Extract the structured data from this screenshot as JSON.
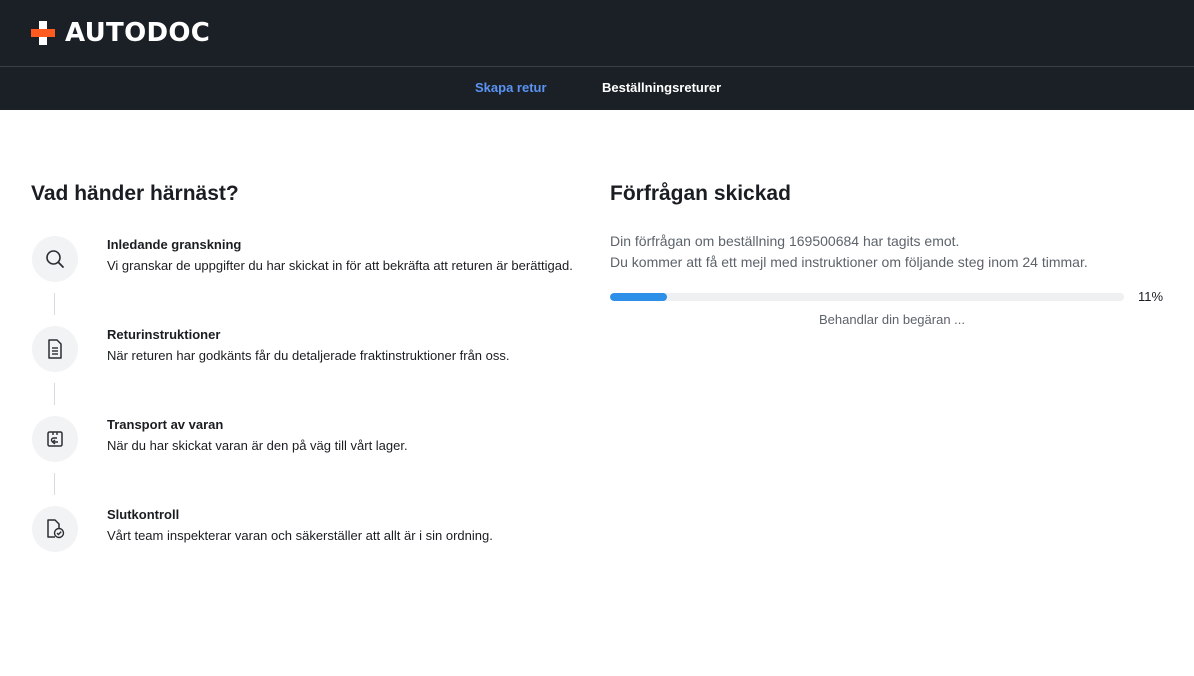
{
  "header": {
    "logo_text": "AUTODOC",
    "brand_color": "#ff5a1f",
    "background_color": "#1b2026"
  },
  "nav": {
    "tabs": [
      {
        "label": "Skapa retur",
        "active": true
      },
      {
        "label": "Beställningsreturer",
        "active": false
      }
    ],
    "active_color": "#5a93f2"
  },
  "left": {
    "title": "Vad händer härnäst?",
    "steps": [
      {
        "icon": "magnifier-icon",
        "title": "Inledande granskning",
        "description": "Vi granskar de uppgifter du har skickat in för att bekräfta att returen är berättigad."
      },
      {
        "icon": "document-icon",
        "title": "Returinstruktioner",
        "description": "När returen har godkänts får du detaljerade fraktinstruktioner från oss."
      },
      {
        "icon": "return-box-icon",
        "title": "Transport av varan",
        "description": "När du har skickat varan är den på väg till vårt lager."
      },
      {
        "icon": "document-check-icon",
        "title": "Slutkontroll",
        "description": "Vårt team inspekterar varan och säkerställer att allt är i sin ordning."
      }
    ]
  },
  "right": {
    "title": "Förfrågan skickad",
    "message_line1": "Din förfrågan om beställning 169500684 har tagits emot.",
    "message_line2": "Du kommer att få ett mejl med instruktioner om följande steg inom 24 timmar.",
    "progress": {
      "percent": 11,
      "label": "11%",
      "fill_color": "#2d8fe8"
    },
    "processing_text": "Behandlar din begäran ..."
  }
}
